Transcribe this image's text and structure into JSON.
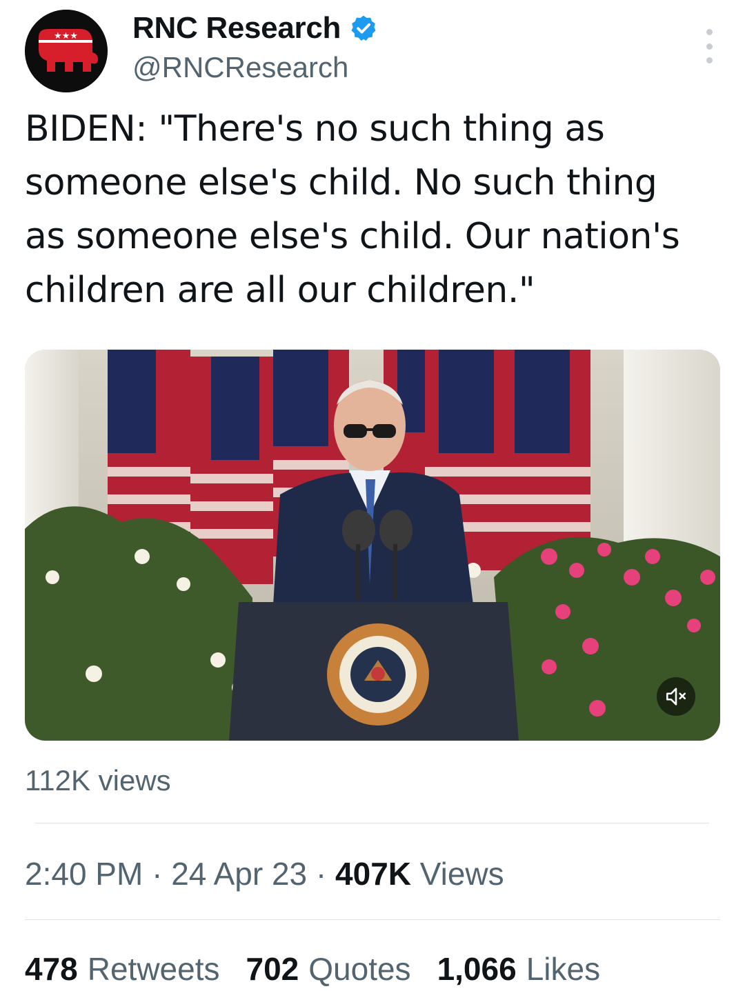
{
  "account": {
    "display_name": "RNC Research",
    "handle": "@RNCResearch",
    "verified_icon": "verified-badge-icon",
    "avatar_icon": "gop-elephant-logo",
    "verified_color": "#1d9bf0",
    "brand_color": "#d71f2b"
  },
  "tweet": {
    "text": "BIDEN: \"There's no such thing as\nsomeone else's child. No such thing\nas someone else's child. Our nation's\nchildren are all our children.\"",
    "video_views": "112K views",
    "mute_icon": "volume-muted-icon"
  },
  "meta": {
    "time": "2:40 PM",
    "separator": "·",
    "date": "24 Apr 23",
    "views_count": "407K",
    "views_label": "Views"
  },
  "stats": {
    "retweets_count": "478",
    "retweets_label": "Retweets",
    "quotes_count": "702",
    "quotes_label": "Quotes",
    "likes_count": "1,066",
    "likes_label": "Likes"
  }
}
